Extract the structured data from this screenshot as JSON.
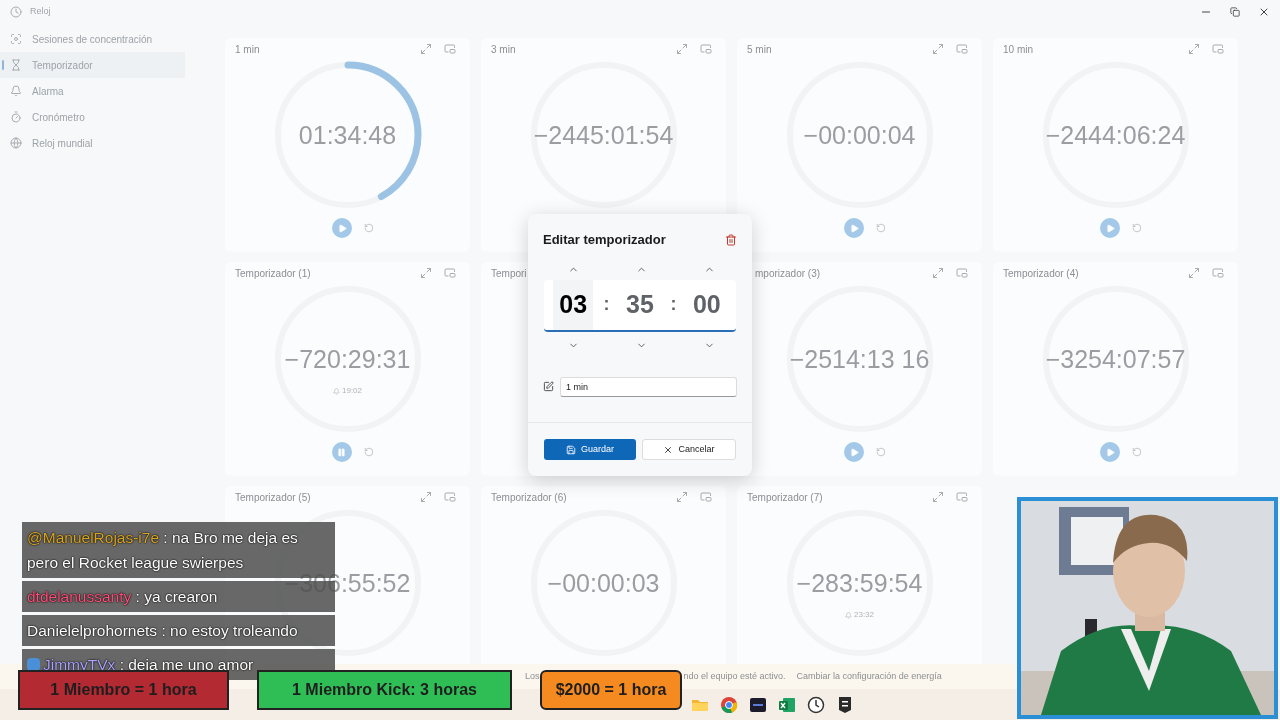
{
  "window": {
    "title": "Reloj"
  },
  "sidebar": {
    "items": [
      {
        "label": "Sesiones de concentración",
        "selected": false
      },
      {
        "label": "Temporizador",
        "selected": true
      },
      {
        "label": "Alarma",
        "selected": false
      },
      {
        "label": "Cronómetro",
        "selected": false
      },
      {
        "label": "Reloj mundial",
        "selected": false
      }
    ]
  },
  "timers": [
    {
      "title": "1 min",
      "time": "01:34:48",
      "level": 0.42,
      "controls": {
        "running": false
      }
    },
    {
      "title": "3 min",
      "time": "−2445:01:54"
    },
    {
      "title": "5 min",
      "time": "−00:00:04",
      "controls": {
        "running": false
      }
    },
    {
      "title": "10 min",
      "time": "−2444:06:24",
      "controls": {
        "running": false
      }
    },
    {
      "title": "Temporizador (1)",
      "time": "−720:29:31",
      "alarm": "19:02",
      "controls": {
        "running": true
      }
    },
    {
      "title": "Tempori",
      "clipped_right": true
    },
    {
      "title": "mporizador (3)",
      "clipped_left": true,
      "time": "−2514:13 16",
      "controls": {
        "running": false
      }
    },
    {
      "title": "Temporizador (4)",
      "time": "−3254:07:57",
      "controls": {
        "running": false
      }
    },
    {
      "title": "Temporizador (5)",
      "time": "−306:55:52"
    },
    {
      "title": "Temporizador (6)",
      "time": "−00:00:03"
    },
    {
      "title": "Temporizador (7)",
      "time": "−283:59:54",
      "alarm": "23:32"
    }
  ],
  "dialog": {
    "title": "Editar temporizador",
    "fields": [
      {
        "value": "03",
        "selected": true
      },
      {
        "value": "35",
        "selected": false
      },
      {
        "value": "00",
        "selected": false
      }
    ],
    "separators": [
      ":",
      ":"
    ],
    "name": "1 min",
    "buttons": [
      {
        "label": "Guardar",
        "kind": "primary"
      },
      {
        "label": "Cancelar",
        "kind": "secondary"
      }
    ]
  },
  "notification": {
    "texts": [
      "Los",
      "ndo el equipo esté activo."
    ],
    "link": "Cambiar la configuración de energía"
  },
  "chat": [
    {
      "user": "@ManuelRojas-i7e",
      "color": "#d9a520",
      "text": ": na Bro me deja es pero el Rocket league swierpes"
    },
    {
      "user": "dtdelanussanty",
      "color": "#ff4f7a",
      "text": ": ya crearon"
    },
    {
      "user": "Danielelprohornets",
      "color": "#ffffff",
      "text": ": no estoy troleando"
    },
    {
      "user": "JimmyTVx",
      "color": "#aaa3ff",
      "text": ": deja me uno amor",
      "badge": true
    }
  ],
  "banners": [
    {
      "text": "1 Miembro = 1 hora",
      "color": "#b32a33"
    },
    {
      "text": "1 Miembro Kick: 3 horas",
      "color": "#2fbe55"
    },
    {
      "text": "$2000 = 1 hora",
      "color": "#f58a20"
    }
  ]
}
